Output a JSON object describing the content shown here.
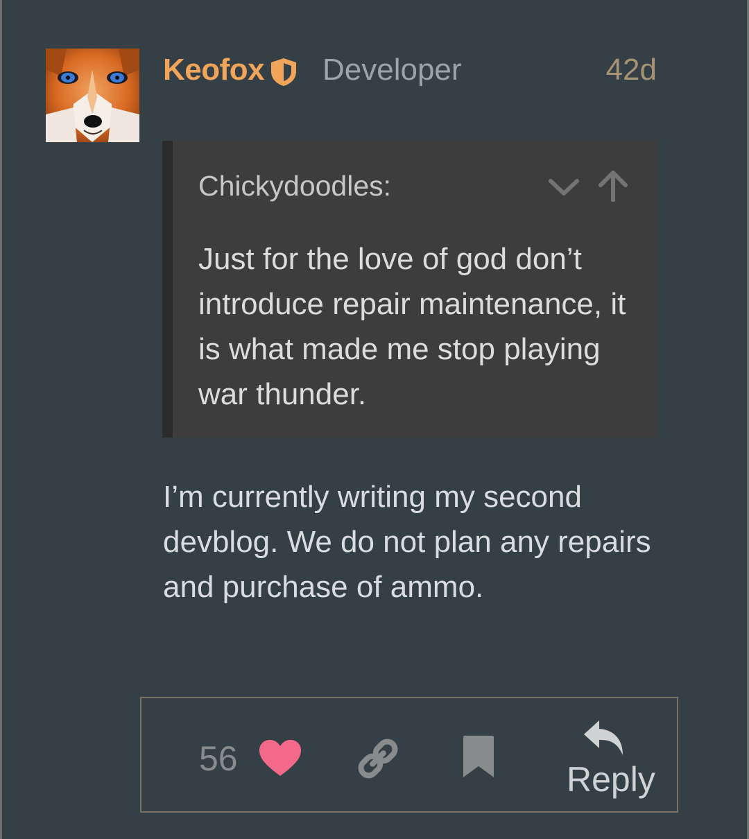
{
  "post": {
    "author": "Keofox",
    "role": "Developer",
    "age": "42d",
    "quote": {
      "author": "Chickydoodles:",
      "text": "Just for the love of god don’t introduce repair maintenance, it is what made me stop playing war thunder."
    },
    "body": "I’m currently writing my second devblog. We do not plan any repairs and purchase of ammo."
  },
  "actions": {
    "like_count": "56",
    "reply_label": "Reply"
  },
  "icons": {
    "badge": "shield-icon",
    "expand": "chevron-down-icon",
    "jump": "arrow-up-icon",
    "like": "heart-icon",
    "share": "link-icon",
    "bookmark": "bookmark-icon",
    "reply": "reply-arrow-icon"
  },
  "colors": {
    "background": "#343f46",
    "author": "#f1a55a",
    "like": "#f4698a"
  }
}
